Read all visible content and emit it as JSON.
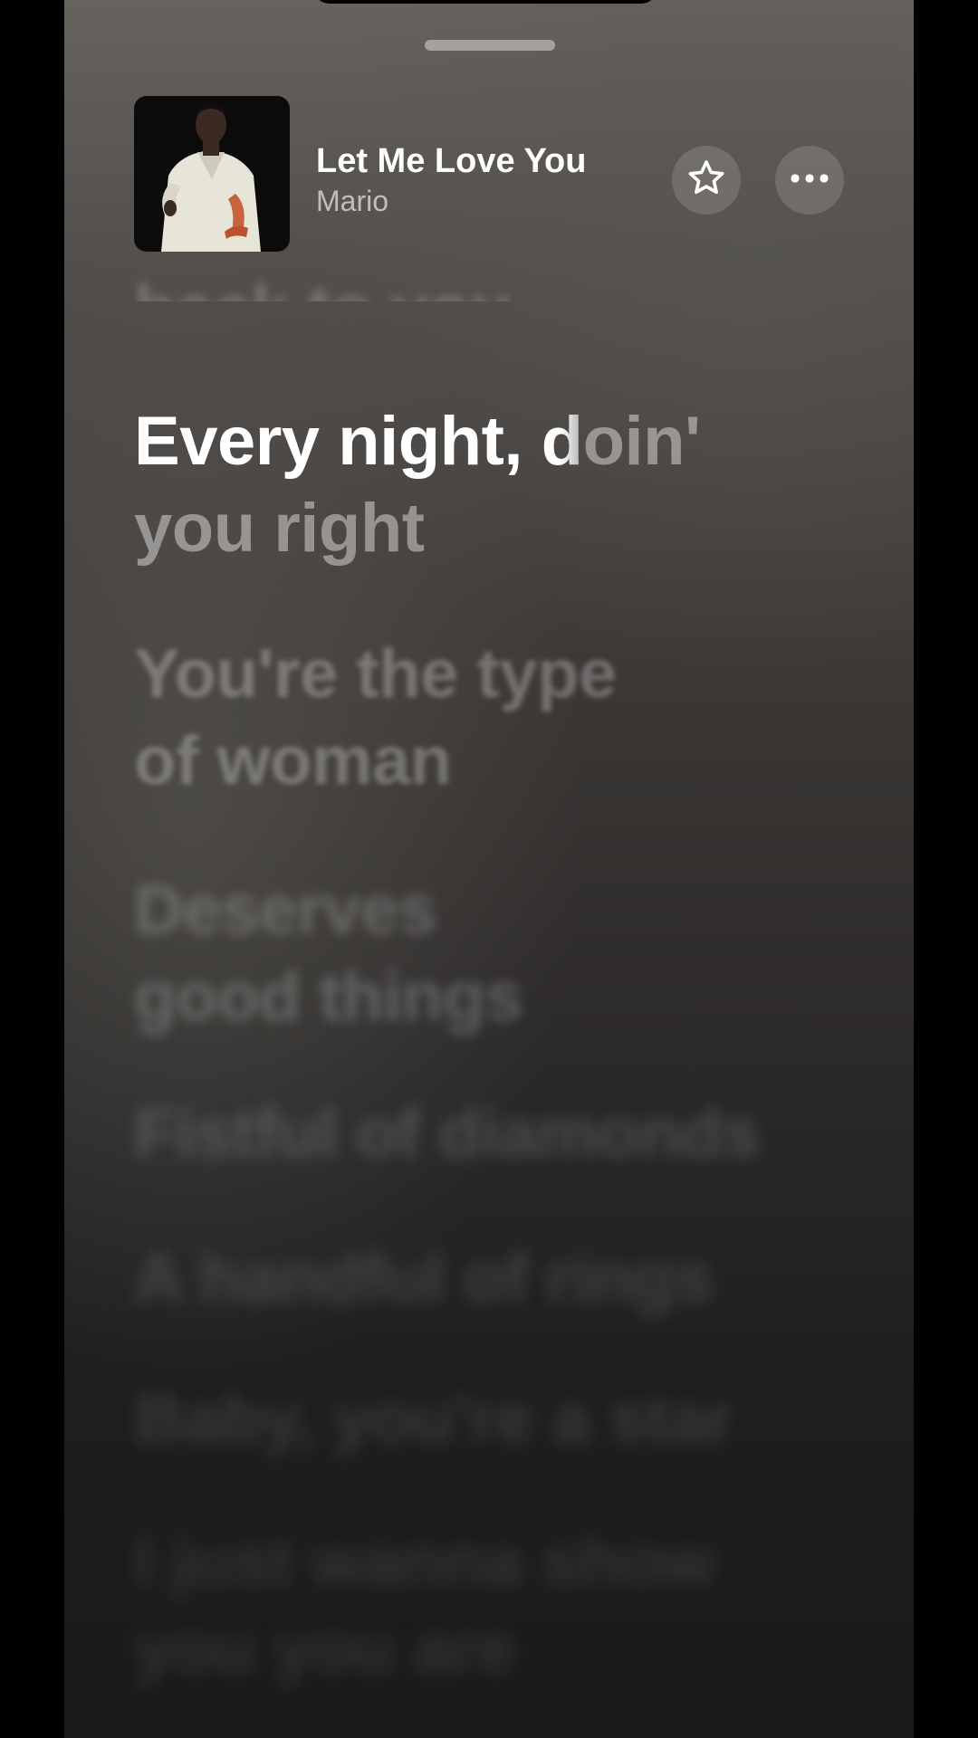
{
  "now_playing": {
    "title": "Let Me Love You",
    "artist": "Mario",
    "favorite_icon": "star-outline-icon",
    "more_icon": "ellipsis-icon"
  },
  "lyrics": {
    "previous": "back to you",
    "current": {
      "sung": "Every night, ",
      "partial": "d",
      "unsung": "oin'",
      "line2": "you right"
    },
    "upcoming": [
      {
        "line1": "You're the type",
        "line2": "of woman"
      },
      {
        "line1": "Deserves",
        "line2": "good things"
      },
      {
        "line1": "Fistful of diamonds"
      },
      {
        "line1": "A handful of rings"
      },
      {
        "line1": "Baby, you're a star"
      },
      {
        "line1": "I just wanna show",
        "line2": "you you are"
      }
    ]
  },
  "colors": {
    "background_top": "#66625e",
    "background_bottom": "#1a1a1a",
    "active_lyric": "#ffffff"
  }
}
